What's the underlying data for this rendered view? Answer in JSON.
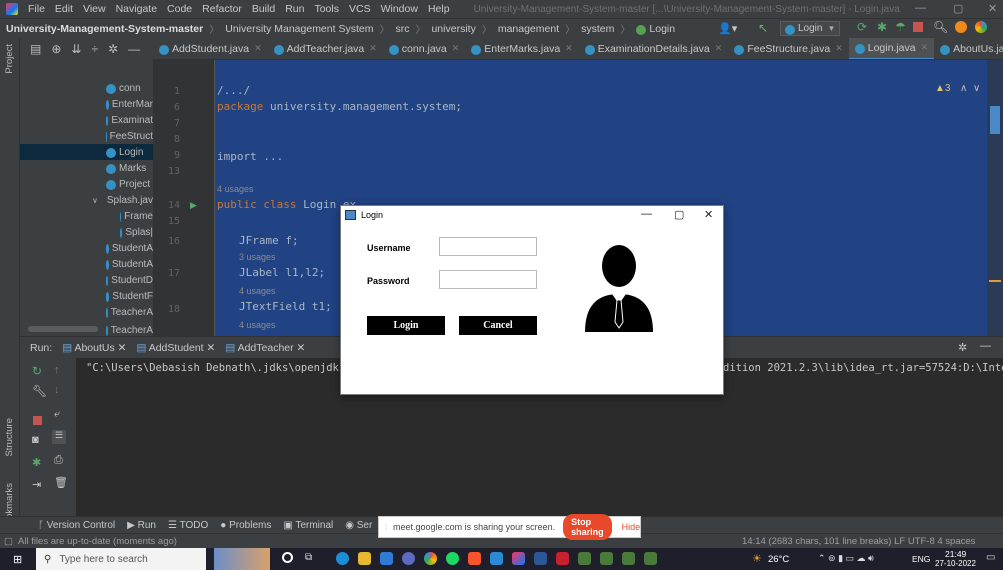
{
  "menubar": {
    "items": [
      "File",
      "Edit",
      "View",
      "Navigate",
      "Code",
      "Refactor",
      "Build",
      "Run",
      "Tools",
      "VCS",
      "Window",
      "Help"
    ],
    "window_title": "University-Management-System-master [...\\University-Management-System-master] - Login.java"
  },
  "navbar": {
    "crumbs": [
      "University-Management-System-master",
      "University Management System",
      "src",
      "university",
      "management",
      "system",
      "Login"
    ],
    "run_config": "Login"
  },
  "left_strip": {
    "project": "Project",
    "structure": "Structure",
    "bookmarks": "Bookmarks"
  },
  "tabs": [
    {
      "label": "AddStudent.java",
      "active": false
    },
    {
      "label": "AddTeacher.java",
      "active": false
    },
    {
      "label": "conn.java",
      "active": false
    },
    {
      "label": "EnterMarks.java",
      "active": false
    },
    {
      "label": "ExaminationDetails.java",
      "active": false
    },
    {
      "label": "FeeStructure.java",
      "active": false
    },
    {
      "label": "Login.java",
      "active": true
    },
    {
      "label": "AboutUs.java",
      "active": false
    }
  ],
  "tree": [
    {
      "label": "conn",
      "selected": false
    },
    {
      "label": "EnterMar",
      "selected": false
    },
    {
      "label": "Examinat",
      "selected": false
    },
    {
      "label": "FeeStruct",
      "selected": false
    },
    {
      "label": "Login",
      "selected": true
    },
    {
      "label": "Marks",
      "selected": false
    },
    {
      "label": "Project",
      "selected": false
    },
    {
      "label": "Splash.jav",
      "selected": false
    },
    {
      "label": "Frame",
      "selected": false
    },
    {
      "label": "Splas|",
      "selected": false
    },
    {
      "label": "StudentA",
      "selected": false
    },
    {
      "label": "StudentA",
      "selected": false
    },
    {
      "label": "StudentD",
      "selected": false
    },
    {
      "label": "StudentF",
      "selected": false
    },
    {
      "label": "TeacherA",
      "selected": false
    },
    {
      "label": "TeacherA",
      "selected": false
    }
  ],
  "gutter": [
    "1",
    "6",
    "7",
    "8",
    "9",
    "13",
    "14",
    "15",
    "16",
    "17",
    "18"
  ],
  "code": {
    "l1": "/.../",
    "l2_kw": "package",
    "l2": " university.management.system;",
    "l3": "import ...",
    "hint1": "4 usages",
    "l4_kw": "public class",
    "l4": " Login ex",
    "l5": "JFrame f;",
    "hint2": "3 usages",
    "l6": "JLabel l1,l2;",
    "hint3": "4 usages",
    "l7": "JTextField t1;",
    "hint4": "4 usages",
    "warnings": "▲3"
  },
  "run": {
    "label": "Run:",
    "tabs": [
      "AboutUs",
      "AddStudent",
      "AddTeacher"
    ],
    "console_left": "\"C:\\Users\\Debasish Debnath\\.jdks\\openjdk-19.0",
    "console_right": "dition 2021.2.3\\lib\\idea_rt.jar=57524:D:\\Intell"
  },
  "bottombar": [
    "Version Control",
    "Run",
    "TODO",
    "Problems",
    "Terminal",
    "Ser"
  ],
  "share": {
    "message": "meet.google.com is sharing your screen.",
    "stop": "Stop sharing",
    "hide": "Hide"
  },
  "status": {
    "left": "All files are up-to-date (moments ago)",
    "right": "14:14 (2683 chars, 101 line breaks)  LF  UTF-8  4 spaces"
  },
  "taskbar": {
    "search": "Type here to search",
    "weather": "26°C",
    "lang": "ENG",
    "time": "21:49",
    "date": "27-10-2022"
  },
  "login": {
    "title": "Login",
    "username_label": "Username",
    "password_label": "Password",
    "username_value": "",
    "password_value": "",
    "login_btn": "Login",
    "cancel_btn": "Cancel"
  },
  "colors": {
    "editor_bg": "#214283",
    "ide_bg": "#3c3f41",
    "accent": "#4a88c7",
    "stop_sharing": "#e8492b"
  }
}
